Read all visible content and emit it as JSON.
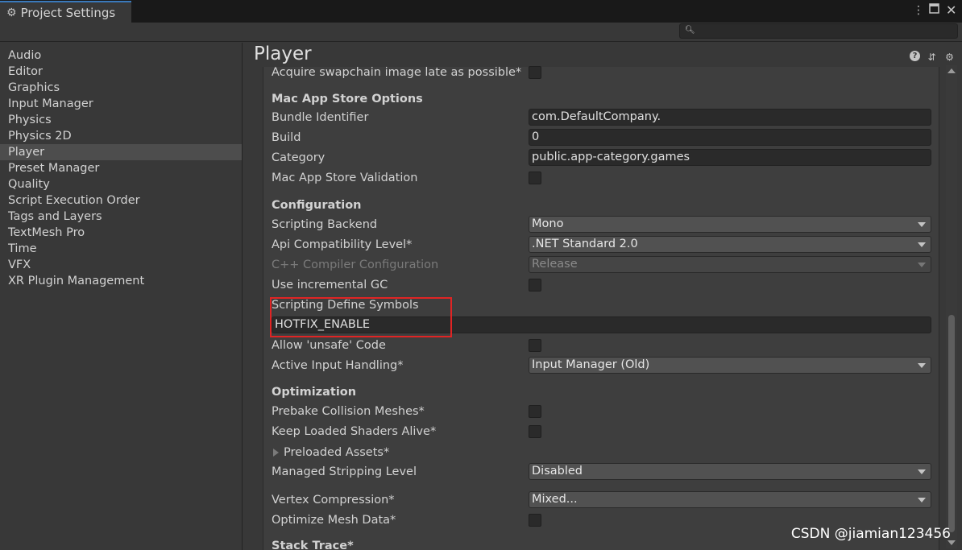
{
  "window": {
    "tab_title": "Project Settings",
    "tab_icon": "gear-icon"
  },
  "search": {
    "placeholder": "",
    "value": ""
  },
  "sidebar": {
    "items": [
      {
        "label": "Audio"
      },
      {
        "label": "Editor"
      },
      {
        "label": "Graphics"
      },
      {
        "label": "Input Manager"
      },
      {
        "label": "Physics"
      },
      {
        "label": "Physics 2D"
      },
      {
        "label": "Player",
        "selected": true
      },
      {
        "label": "Preset Manager"
      },
      {
        "label": "Quality"
      },
      {
        "label": "Script Execution Order"
      },
      {
        "label": "Tags and Layers"
      },
      {
        "label": "TextMesh Pro"
      },
      {
        "label": "Time"
      },
      {
        "label": "VFX"
      },
      {
        "label": "XR Plugin Management"
      }
    ]
  },
  "main": {
    "title": "Player",
    "top_row": {
      "label": "Acquire swapchain image late as possible*",
      "checked": false
    },
    "mac_app_store": {
      "title": "Mac App Store Options",
      "bundle_identifier": {
        "label": "Bundle Identifier",
        "value": "com.DefaultCompany."
      },
      "build": {
        "label": "Build",
        "value": "0"
      },
      "category": {
        "label": "Category",
        "value": "public.app-category.games"
      },
      "validation": {
        "label": "Mac App Store Validation",
        "checked": false
      }
    },
    "configuration": {
      "title": "Configuration",
      "scripting_backend": {
        "label": "Scripting Backend",
        "value": "Mono"
      },
      "api_level": {
        "label": "Api Compatibility Level*",
        "value": ".NET Standard 2.0"
      },
      "cpp_compiler": {
        "label": "C++ Compiler Configuration",
        "value": "Release"
      },
      "incremental_gc": {
        "label": "Use incremental GC",
        "checked": false
      },
      "define_symbols": {
        "label": "Scripting Define Symbols",
        "value": "HOTFIX_ENABLE"
      },
      "unsafe_code": {
        "label": "Allow 'unsafe' Code",
        "checked": false
      },
      "input_handling": {
        "label": "Active Input Handling*",
        "value": "Input Manager (Old)"
      }
    },
    "optimization": {
      "title": "Optimization",
      "prebake": {
        "label": "Prebake Collision Meshes*",
        "checked": false
      },
      "keep_shaders": {
        "label": "Keep Loaded Shaders Alive*",
        "checked": false
      },
      "preloaded_assets": {
        "label": "Preloaded Assets*"
      },
      "stripping": {
        "label": "Managed Stripping Level",
        "value": "Disabled"
      },
      "vertex_compression": {
        "label": "Vertex Compression*",
        "value": "Mixed..."
      },
      "optimize_mesh": {
        "label": "Optimize Mesh Data*",
        "checked": false
      }
    },
    "next_section": {
      "title": "Stack Trace*"
    }
  },
  "highlight_color": "#e02424",
  "watermark": "CSDN @jiamian123456"
}
